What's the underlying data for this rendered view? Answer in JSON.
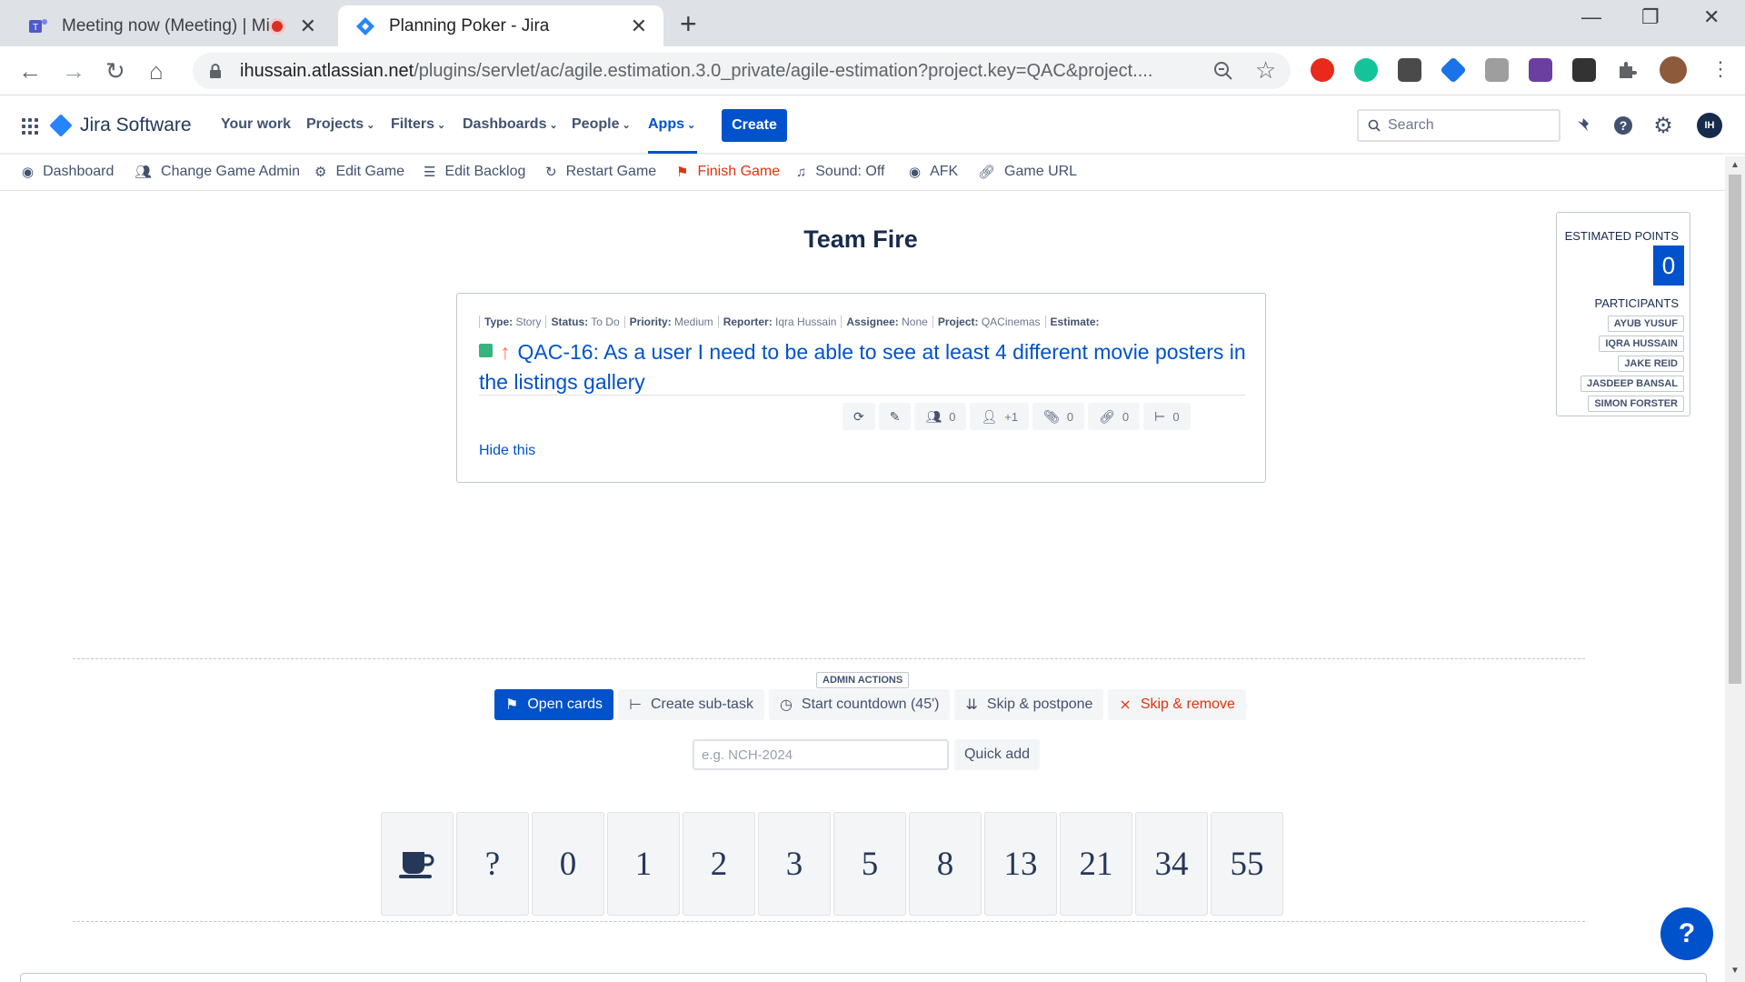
{
  "browser": {
    "tabs": [
      {
        "title": "Meeting now (Meeting) | Microsoft Teams",
        "icon": "teams-icon"
      },
      {
        "title": "Planning Poker - Jira",
        "icon": "jira-icon"
      }
    ],
    "url_host": "ihussain.atlassian.net",
    "url_path": "/plugins/servlet/ac/agile.estimation.3.0_private/agile-estimation?project.key=QAC&project...."
  },
  "jira": {
    "product": "Jira Software",
    "nav": [
      "Your work",
      "Projects",
      "Filters",
      "Dashboards",
      "People",
      "Apps"
    ],
    "create": "Create",
    "search_placeholder": "Search",
    "avatar_initials": "IH"
  },
  "toolbar": {
    "dashboard": "Dashboard",
    "change_admin": "Change Game Admin",
    "edit_game": "Edit Game",
    "edit_backlog": "Edit Backlog",
    "restart": "Restart Game",
    "finish": "Finish Game",
    "sound": "Sound: Off",
    "afk": "AFK",
    "game_url": "Game URL"
  },
  "team": "Team Fire",
  "issue": {
    "meta": [
      {
        "label": "Type:",
        "value": "Story"
      },
      {
        "label": "Status:",
        "value": "To Do"
      },
      {
        "label": "Priority:",
        "value": "Medium"
      },
      {
        "label": "Reporter:",
        "value": "Iqra Hussain"
      },
      {
        "label": "Assignee:",
        "value": "None"
      },
      {
        "label": "Project:",
        "value": "QACinemas"
      },
      {
        "label": "Estimate:",
        "value": ""
      }
    ],
    "title": "QAC-16: As a user I need to be able to see at least 4 different movie posters in the listings gallery",
    "counts": {
      "votes": "0",
      "watchers": "+1",
      "attachments": "0",
      "links": "0",
      "subtasks": "0"
    },
    "hide": "Hide this"
  },
  "side": {
    "estimated_label": "ESTIMATED POINTS",
    "points": "0",
    "participants_label": "PARTICIPANTS",
    "participants": [
      "AYUB YUSUF",
      "IQRA HUSSAIN",
      "JAKE REID",
      "JASDEEP BANSAL",
      "SIMON FORSTER"
    ]
  },
  "admin": {
    "label": "ADMIN ACTIONS",
    "open_cards": "Open cards",
    "create_subtask": "Create sub-task",
    "countdown": "Start countdown (45')",
    "skip_postpone": "Skip & postpone",
    "skip_remove": "Skip & remove",
    "quick_placeholder": "e.g. NCH-2024",
    "quick_add": "Quick add"
  },
  "cards": [
    "coffee",
    "?",
    "0",
    "1",
    "2",
    "3",
    "5",
    "8",
    "13",
    "21",
    "34",
    "55"
  ],
  "help": "?",
  "colors": {
    "brand": "#0052cc",
    "danger": "#de350b",
    "story": "#36b37e"
  }
}
